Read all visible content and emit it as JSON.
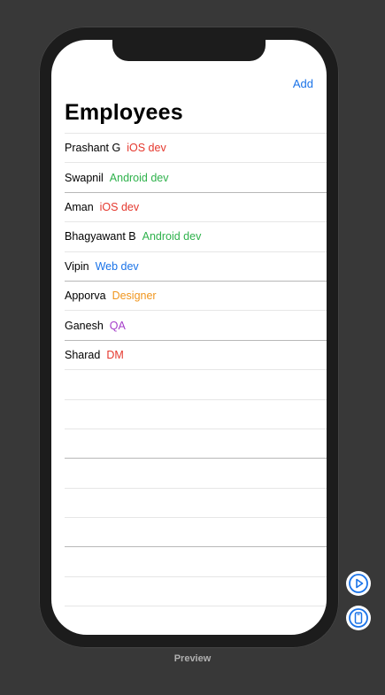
{
  "nav": {
    "add_label": "Add",
    "title": "Employees"
  },
  "employees": [
    {
      "name": "Prashant G",
      "role": "iOS dev",
      "role_color": "#e5382e"
    },
    {
      "name": "Swapnil",
      "role": "Android dev",
      "role_color": "#2fb24c"
    },
    {
      "name": "Aman",
      "role": "iOS dev",
      "role_color": "#e5382e"
    },
    {
      "name": "Bhagyawant B",
      "role": "Android dev",
      "role_color": "#2fb24c"
    },
    {
      "name": "Vipin",
      "role": "Web dev",
      "role_color": "#1a73e8"
    },
    {
      "name": "Apporva",
      "role": "Designer",
      "role_color": "#f0961e"
    },
    {
      "name": "Ganesh",
      "role": "QA",
      "role_color": "#a53dc9"
    },
    {
      "name": "Sharad",
      "role": "DM",
      "role_color": "#e5382e"
    }
  ],
  "empty_rows": 9,
  "preview_caption": "Preview",
  "controls": {
    "play_icon": "play-circle-icon",
    "device_icon": "device-icon",
    "accent": "#1a73e8"
  }
}
